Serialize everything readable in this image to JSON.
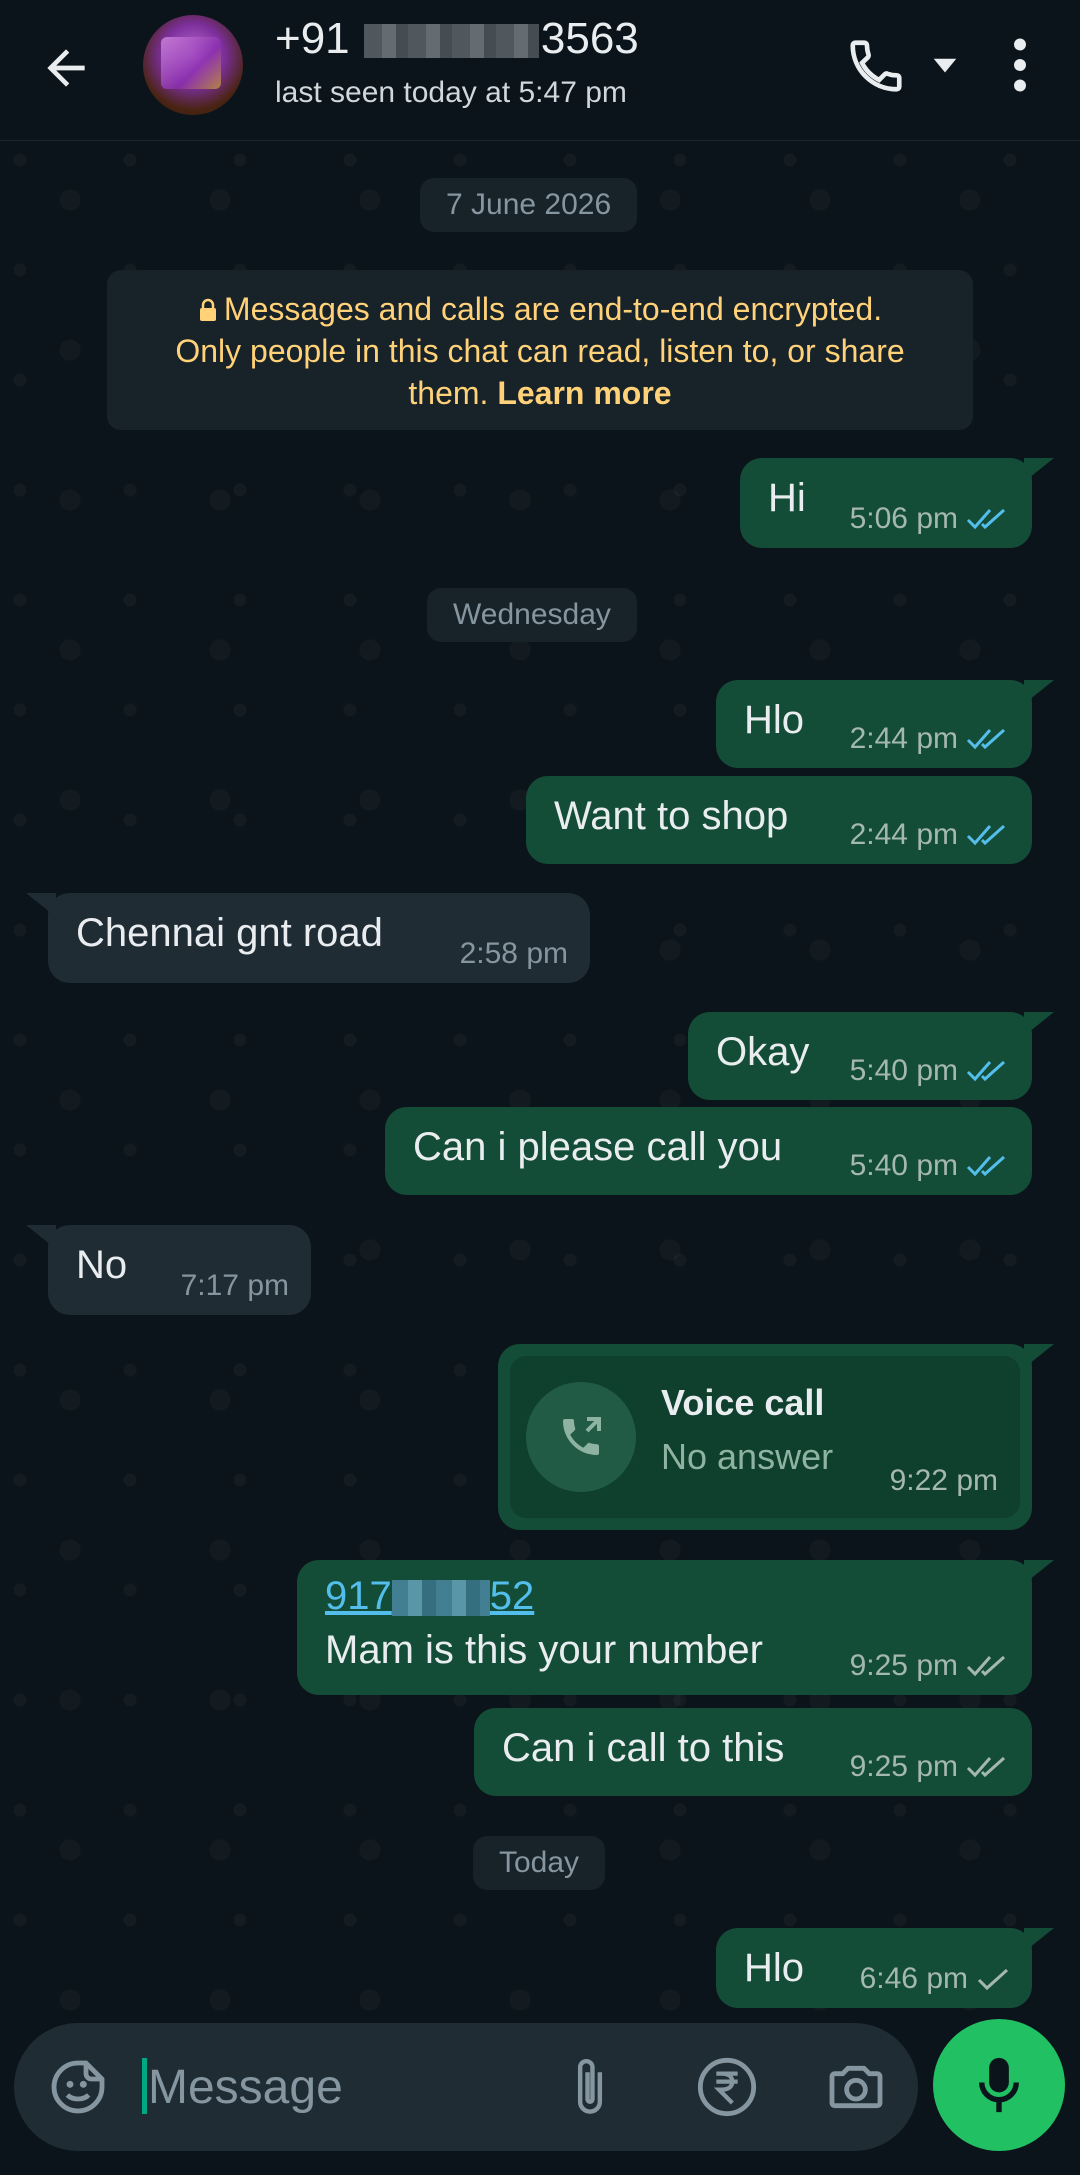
{
  "header": {
    "contact_prefix": "+91",
    "contact_suffix": "3563",
    "status": "last seen today at 5:47 pm"
  },
  "chat": {
    "date_pill": "7 June 2026",
    "encryption_notice_line1": "Messages and calls are end-to-end encrypted.",
    "encryption_notice_line2": "Only people in this chat can read, listen to, or share",
    "encryption_notice_line3": "them.",
    "encryption_learn_more": "Learn more",
    "wednesday_pill": "Wednesday",
    "today_pill": "Today",
    "messages": [
      {
        "direction": "out",
        "text": "Hi",
        "time": "5:06 pm",
        "status": "read"
      },
      {
        "direction": "out",
        "text": "Hlo",
        "time": "2:44 pm",
        "status": "read"
      },
      {
        "direction": "out",
        "text": "Want to shop",
        "time": "2:44 pm",
        "status": "read"
      },
      {
        "direction": "in",
        "text": "Chennai gnt road",
        "time": "2:58 pm"
      },
      {
        "direction": "out",
        "text": "Okay",
        "time": "5:40 pm",
        "status": "read"
      },
      {
        "direction": "out",
        "text": "Can i please call you",
        "time": "5:40 pm",
        "status": "read"
      },
      {
        "direction": "in",
        "text": "No",
        "time": "7:17 pm"
      },
      {
        "direction": "out",
        "text": "Mam is this your number",
        "time": "9:25 pm",
        "status": "delivered",
        "link_prefix": "917",
        "link_suffix": "52"
      },
      {
        "direction": "out",
        "text": "Can i call to this",
        "time": "9:25 pm",
        "status": "delivered"
      },
      {
        "direction": "out",
        "text": "Hlo",
        "time": "6:46 pm",
        "status": "sent"
      }
    ],
    "voice_call": {
      "title": "Voice call",
      "subtitle": "No answer",
      "time": "9:22 pm"
    }
  },
  "input": {
    "placeholder": "Message"
  },
  "colors": {
    "background": "#0b141a",
    "outgoing_bubble": "#144d37",
    "incoming_bubble": "#1f2c34",
    "read_tick": "#53bdeb",
    "accent_green": "#21c063",
    "notice_text": "#ffd279"
  },
  "icons": [
    "back-arrow-icon",
    "phone-icon",
    "dropdown-caret-icon",
    "more-vert-icon",
    "lock-icon",
    "double-tick-icon",
    "single-tick-icon",
    "missed-call-icon",
    "sticker-icon",
    "attach-icon",
    "rupee-icon",
    "camera-icon",
    "mic-icon"
  ]
}
